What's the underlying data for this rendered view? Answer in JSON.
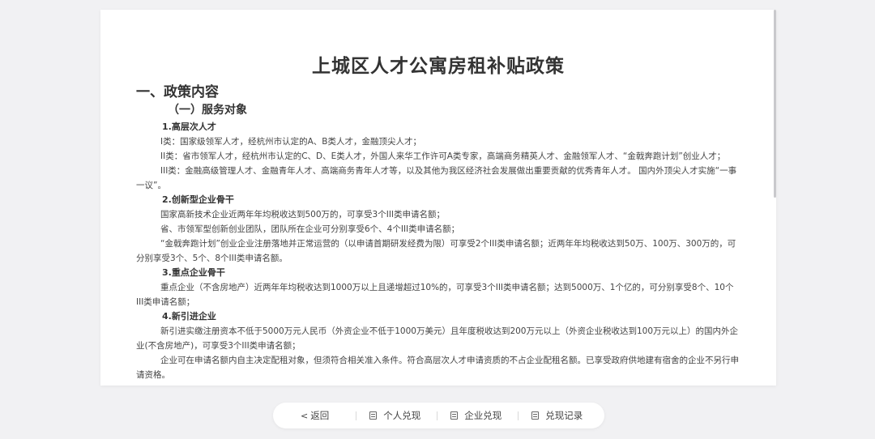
{
  "document": {
    "title": "上城区人才公寓房租补贴政策",
    "section1": "一、政策内容",
    "subsection1": "（一）服务对象",
    "cat1": {
      "heading": "1.高层次人才",
      "p1": "I类：国家级领军人才，经杭州市认定的A、B类人才，金融顶尖人才；",
      "p2": "II类：省市领军人才，经杭州市认定的C、D、E类人才，外国人来华工作许可A类专家，高端商务精英人才、金融领军人才、“金戟奔跑计划”创业人才；",
      "p3": "III类：金融高级管理人才、金融青年人才、高端商务青年人才等，以及其他为我区经济社会发展做出重要贡献的优秀青年人才。 国内外顶尖人才实施“一事一议”。"
    },
    "cat2": {
      "heading": "2.创新型企业骨干",
      "p1": "国家高新技术企业近两年年均税收达到500万的，可享受3个III类申请名额；",
      "p2": "省、市领军型创新创业团队，团队所在企业可分别享受6个、4个III类申请名额；",
      "p3": "“金戟奔跑计划”创业企业注册落地并正常运营的（以申请首期研发经费为限）可享受2个III类申请名额；近两年年均税收达到50万、100万、300万的，可分别享受3个、5个、8个III类申请名额。"
    },
    "cat3": {
      "heading": "3.重点企业骨干",
      "p1": "重点企业（不含房地产）近两年年均税收达到1000万以上且递增超过10%的，可享受3个III类申请名额；达到5000万、1个亿的，可分别享受8个、10个III类申请名额；"
    },
    "cat4": {
      "heading": "4.新引进企业",
      "p1": "新引进实缴注册资本不低于5000万元人民币（外资企业不低于1000万美元）且年度税收达到200万元以上（外资企业税收达到100万元以上）的国内外企业(不含房地产)，可享受3个III类申请名额；",
      "p2": "企业可在申请名额内自主决定配租对象，但须符合相关准入条件。符合高层次人才申请资质的不占企业配租名额。已享受政府供地建有宿舍的企业不另行申请资格。"
    }
  },
  "bottom_bar": {
    "back_label": "返回",
    "back_icon": "chevron-left-icon",
    "personal_label": "个人兑现",
    "enterprise_label": "企业兑现",
    "records_label": "兑现记录"
  }
}
